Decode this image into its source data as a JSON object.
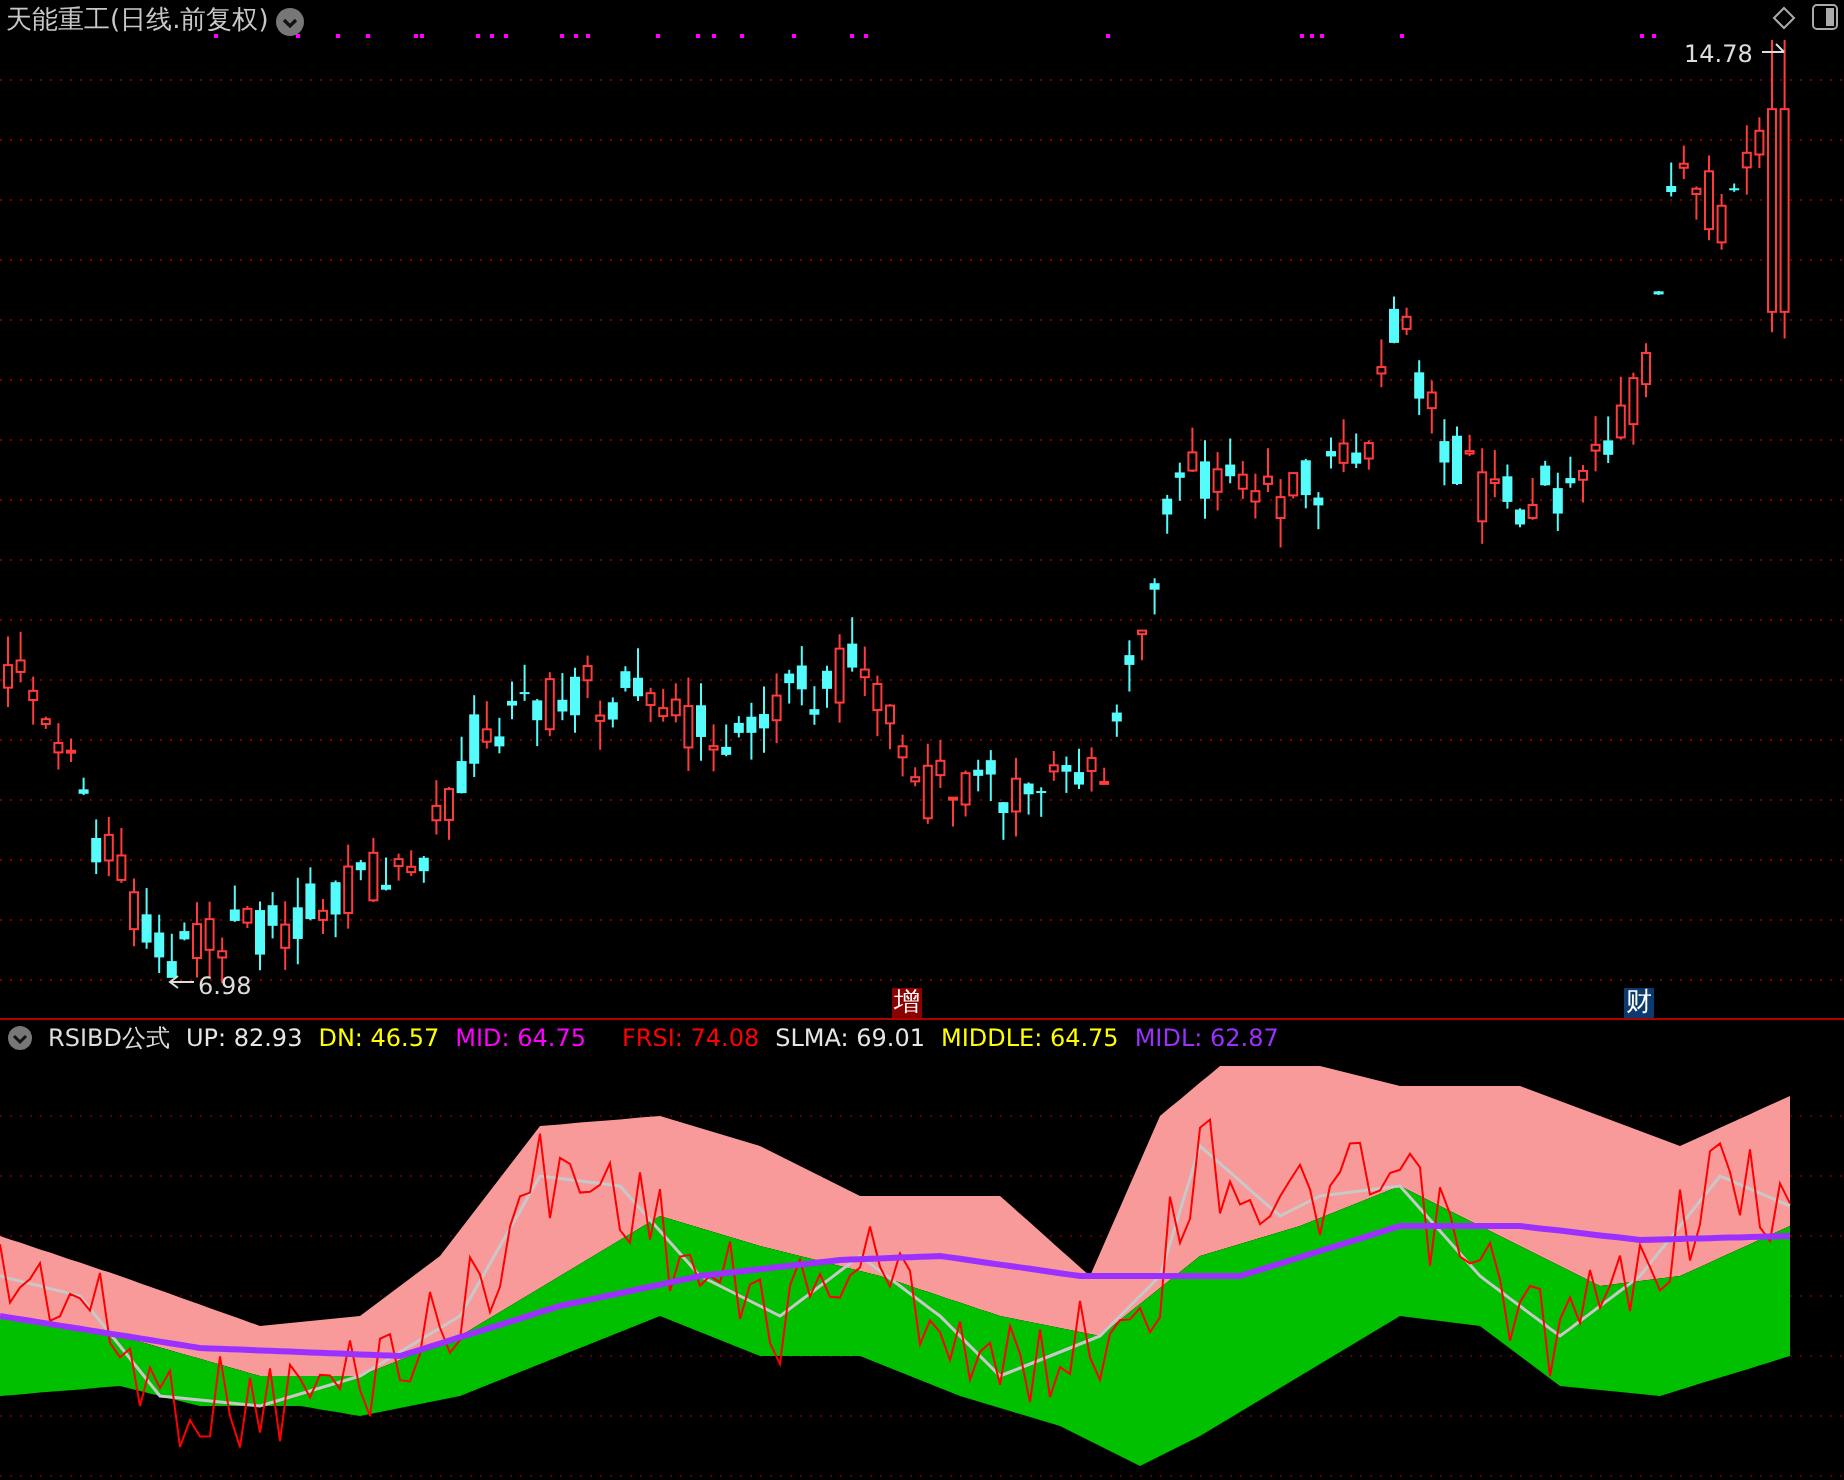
{
  "title": "天能重工(日线.前复权)",
  "main_chart": {
    "high_label": "14.78",
    "low_label": "6.98",
    "markers": [
      {
        "text": "增",
        "color": "#8b0000"
      },
      {
        "text": "财",
        "color": "#0d3a6e"
      }
    ]
  },
  "indicator": {
    "name": "RSIBD公式",
    "values": [
      {
        "label": "UP: 82.93",
        "color": "#e6e6e6"
      },
      {
        "label": "DN: 46.57",
        "color": "#ffff00"
      },
      {
        "label": "MID: 64.75",
        "color": "#ff00ff"
      },
      {
        "label": "FRSI: 74.08",
        "color": "#ff0000"
      },
      {
        "label": "SLMA: 69.01",
        "color": "#e6e6e6"
      },
      {
        "label": "MIDDLE: 64.75",
        "color": "#ffff00"
      },
      {
        "label": "MIDL: 62.87",
        "color": "#9b30ff"
      }
    ]
  }
}
